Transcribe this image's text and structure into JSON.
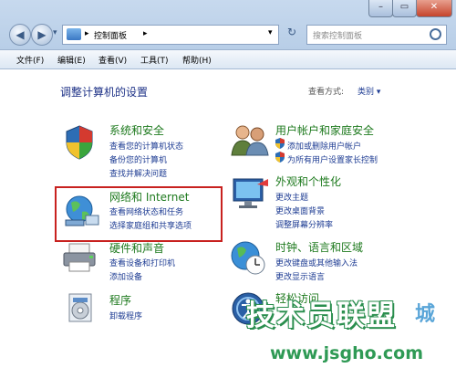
{
  "window": {
    "minimize_glyph": "–",
    "maximize_glyph": "▭",
    "close_glyph": "✕"
  },
  "nav": {
    "back_glyph": "◀",
    "forward_glyph": "▶",
    "dropdown_glyph": "▾",
    "refresh_glyph": "↻"
  },
  "address": {
    "sep1": "▸",
    "crumb": "控制面板",
    "sep2": "▸"
  },
  "search": {
    "placeholder": "搜索控制面板"
  },
  "menu": [
    "文件(F)",
    "编辑(E)",
    "查看(V)",
    "工具(T)",
    "帮助(H)"
  ],
  "page": {
    "heading": "调整计算机的设置",
    "view_by_label": "查看方式:",
    "view_by_value": "类别 ▾"
  },
  "categories": [
    {
      "title": "系统和安全",
      "links": [
        "查看您的计算机状态",
        "备份您的计算机",
        "查找并解决问题"
      ]
    },
    {
      "title": "网络和 Internet",
      "links": [
        "查看网络状态和任务",
        "选择家庭组和共享选项"
      ]
    },
    {
      "title": "硬件和声音",
      "links": [
        "查看设备和打印机",
        "添加设备"
      ]
    },
    {
      "title": "程序",
      "links": [
        "卸载程序"
      ]
    },
    {
      "title": "用户帐户和家庭安全",
      "links": [
        "添加或删除用户帐户",
        "为所有用户设置家长控制"
      ]
    },
    {
      "title": "外观和个性化",
      "links": [
        "更改主题",
        "更改桌面背景",
        "调整屏幕分辨率"
      ]
    },
    {
      "title": "时钟、语言和区域",
      "links": [
        "更改键盘或其他输入法",
        "更改显示语言"
      ]
    },
    {
      "title": "轻松访问",
      "links": []
    }
  ],
  "watermark": {
    "main": "技术员联盟",
    "suffix": "城",
    "url": "www.jsgho.com"
  }
}
